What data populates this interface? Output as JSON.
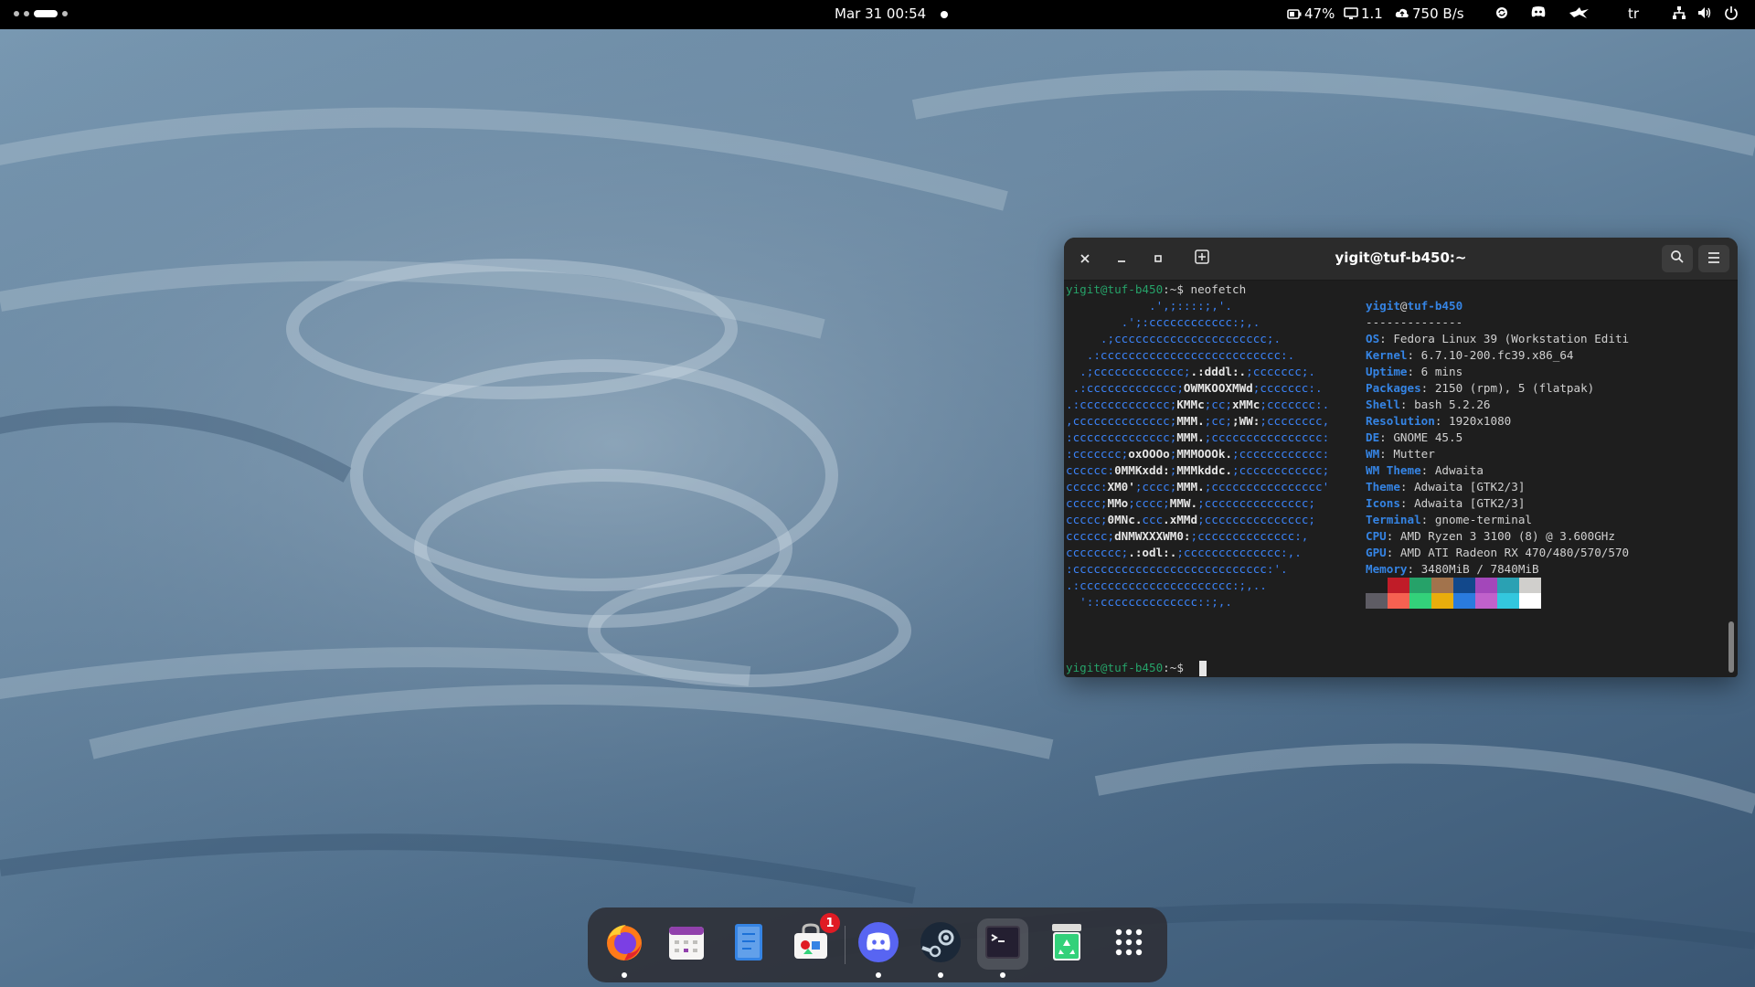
{
  "topbar": {
    "clock": "Mar 31  00:54",
    "battery_percent": "47%",
    "display_value": "1.1",
    "network_speed": "750 B/s",
    "keyboard_layout": "tr",
    "workspaces": {
      "count": 4,
      "active_index": 2
    }
  },
  "terminal": {
    "title": "yigit@tuf-b450:~",
    "prompt": "yigit@tuf-b450",
    "prompt_suffix": ":~$",
    "command": " neofetch",
    "header_user": "yigit",
    "header_at": "@",
    "header_host": "tuf-b450",
    "separator": "--------------",
    "info": [
      {
        "key": "OS",
        "value": "Fedora Linux 39 (Workstation Editi"
      },
      {
        "key": "Kernel",
        "value": "6.7.10-200.fc39.x86_64"
      },
      {
        "key": "Uptime",
        "value": "6 mins"
      },
      {
        "key": "Packages",
        "value": "2150 (rpm), 5 (flatpak)"
      },
      {
        "key": "Shell",
        "value": "bash 5.2.26"
      },
      {
        "key": "Resolution",
        "value": "1920x1080"
      },
      {
        "key": "DE",
        "value": "GNOME 45.5"
      },
      {
        "key": "WM",
        "value": "Mutter"
      },
      {
        "key": "WM Theme",
        "value": "Adwaita"
      },
      {
        "key": "Theme",
        "value": "Adwaita [GTK2/3]"
      },
      {
        "key": "Icons",
        "value": "Adwaita [GTK2/3]"
      },
      {
        "key": "Terminal",
        "value": "gnome-terminal"
      },
      {
        "key": "CPU",
        "value": "AMD Ryzen 3 3100 (8) @ 3.600GHz"
      },
      {
        "key": "GPU",
        "value": "AMD ATI Radeon RX 470/480/570/570"
      },
      {
        "key": "Memory",
        "value": "3480MiB / 7840MiB"
      }
    ],
    "logo": [
      [
        "            .',;::::;,'.",
        ""
      ],
      [
        "        .';:cccccccccccc:;,.",
        ""
      ],
      [
        "     .;cccccccccccccccccccccc;.",
        ""
      ],
      [
        "   .:cccccccccccccccccccccccccc:.",
        ""
      ],
      [
        "  .;ccccccccccccc;",
        ".:dddl:.",
        ";ccccccc;."
      ],
      [
        " .:ccccccccccccc;",
        "OWMKOOXMWd",
        ";ccccccc:."
      ],
      [
        ".:ccccccccccccc;",
        "KMMc",
        ";cc;",
        "xMMc",
        ";ccccccc:."
      ],
      [
        ",cccccccccccccc;",
        "MMM.",
        ";cc;",
        ";WW:",
        ";cccccccc,"
      ],
      [
        ":cccccccccccccc;",
        "MMM.",
        ";cccccccccccccccc:"
      ],
      [
        ":ccccccc;",
        "oxOOOo",
        ";",
        "MMMOOOk.",
        ";cccccccccccc:"
      ],
      [
        "cccccc:",
        "0MMKxdd:",
        ";",
        "MMMkddc.",
        ";cccccccccccc;"
      ],
      [
        "ccccc:",
        "XM0'",
        ";cccc;",
        "MMM.",
        ";cccccccccccccccc'"
      ],
      [
        "ccccc;",
        "MMo",
        ";cccc;",
        "MMW.",
        ";ccccccccccccccc;"
      ],
      [
        "ccccc;",
        "0MNc.",
        "ccc",
        ".xMMd",
        ";ccccccccccccccc;"
      ],
      [
        "cccccc;",
        "dNMWXXXWM0:",
        ";cccccccccccccc:,"
      ],
      [
        "cccccccc;",
        ".:odl:.",
        ";cccccccccccccc:,."
      ],
      [
        ":cccccccccccccccccccccccccccc:'.",
        ""
      ],
      [
        ".:cccccccccccccccccccccc:;,..",
        ""
      ],
      [
        "  '::cccccccccccccc::;,.",
        ""
      ]
    ],
    "palette_top": [
      "#1e1e1e",
      "#c01c28",
      "#26a269",
      "#a2734c",
      "#12488b",
      "#a347ba",
      "#2aa1b3",
      "#d0cfcc"
    ],
    "palette_bottom": [
      "#5e5c64",
      "#f66151",
      "#33d17a",
      "#e9ad0c",
      "#2a7bde",
      "#c061cb",
      "#33c7de",
      "#ffffff"
    ]
  },
  "dock": {
    "apps": [
      {
        "name": "Firefox",
        "running": true
      },
      {
        "name": "Calendar",
        "running": false
      },
      {
        "name": "Text Editor",
        "running": false
      },
      {
        "name": "Software",
        "running": false,
        "badge": "1"
      },
      {
        "name": "Discord",
        "running": true
      },
      {
        "name": "Steam",
        "running": true
      },
      {
        "name": "Terminal",
        "running": true,
        "active": true
      },
      {
        "name": "Trash",
        "running": false
      },
      {
        "name": "Show Applications",
        "running": false
      }
    ]
  },
  "colors": {
    "accent_blue": "#3584e4",
    "prompt_green": "#26a269",
    "logo_blue": "#3b82f6",
    "badge_red": "#e01b24"
  }
}
